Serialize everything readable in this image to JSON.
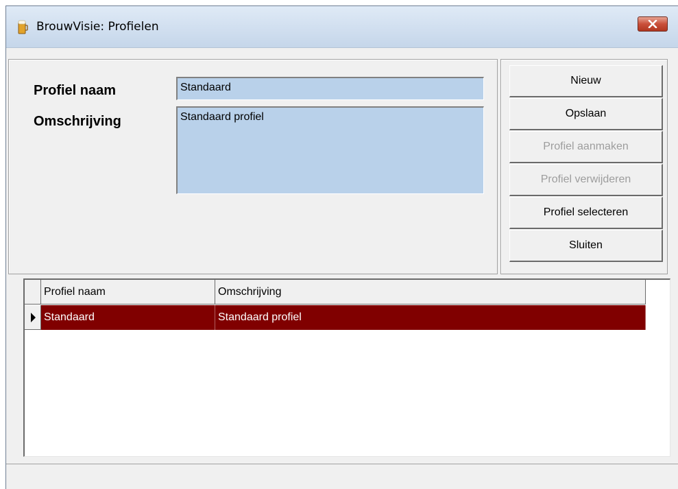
{
  "window": {
    "title": "BrouwVisie: Profielen",
    "icon": "beer-glass-icon"
  },
  "form": {
    "name_label": "Profiel naam",
    "name_value": "Standaard",
    "description_label": "Omschrijving",
    "description_value": "Standaard profiel"
  },
  "buttons": {
    "new": "Nieuw",
    "save": "Opslaan",
    "create_profile": "Profiel aanmaken",
    "delete_profile": "Profiel verwijderen",
    "select_profile": "Profiel selecteren",
    "close": "Sluiten"
  },
  "grid": {
    "columns": [
      "Profiel naam",
      "Omschrijving"
    ],
    "rows": [
      {
        "name": "Standaard",
        "description": "Standaard profiel",
        "selected": true
      }
    ]
  },
  "colors": {
    "selected_row": "#800000",
    "field_background": "#b9d1ea"
  }
}
